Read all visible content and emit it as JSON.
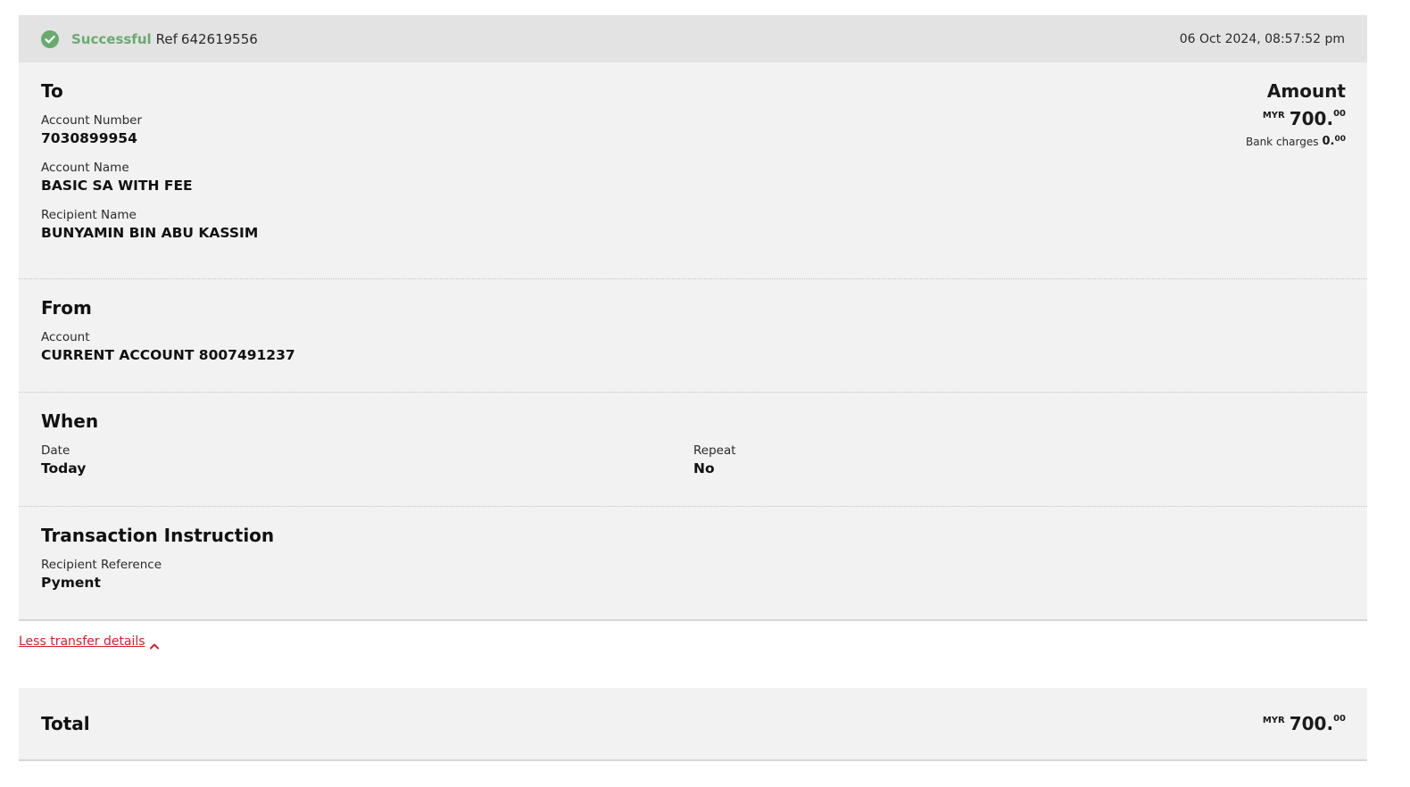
{
  "status": {
    "text": "Successful",
    "ref_label": "Ref",
    "ref_number": "642619556",
    "timestamp": "06 Oct 2024, 08:57:52 pm",
    "icon": "check-circle-icon",
    "color": "#6aaa6f"
  },
  "to": {
    "title": "To",
    "account_number_label": "Account Number",
    "account_number": "7030899954",
    "account_name_label": "Account Name",
    "account_name": "BASIC SA WITH FEE",
    "recipient_name_label": "Recipient Name",
    "recipient_name": "BUNYAMIN BIN ABU KASSIM"
  },
  "amount": {
    "title": "Amount",
    "currency": "MYR",
    "integer": "700.",
    "decimal": "00",
    "bank_charges_label": "Bank charges",
    "bank_charges_integer": "0.",
    "bank_charges_decimal": "00"
  },
  "from": {
    "title": "From",
    "account_label": "Account",
    "account": "CURRENT ACCOUNT 8007491237"
  },
  "when": {
    "title": "When",
    "date_label": "Date",
    "date": "Today",
    "repeat_label": "Repeat",
    "repeat": "No"
  },
  "instruction": {
    "title": "Transaction Instruction",
    "recipient_reference_label": "Recipient Reference",
    "recipient_reference": "Pyment"
  },
  "toggle": {
    "label": "Less transfer details",
    "icon": "chevron-up-icon",
    "color": "#d8202a"
  },
  "total": {
    "label": "Total",
    "currency": "MYR",
    "integer": "700.",
    "decimal": "00"
  }
}
